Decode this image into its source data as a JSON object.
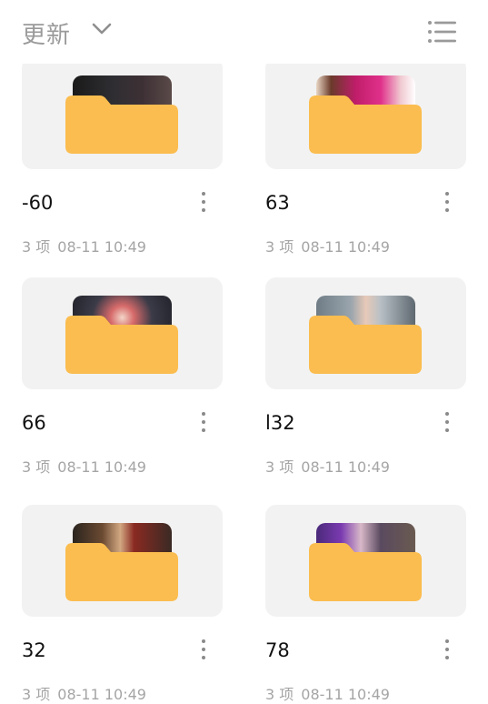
{
  "header": {
    "sort_label": "更新",
    "sort_icon": "chevron-down-icon",
    "view_icon": "list-view-icon"
  },
  "colors": {
    "folder": "#fbbd4f",
    "card_bg": "#f2f2f2",
    "name_text": "#111111",
    "meta_text": "#a5a5a5"
  },
  "folders": [
    {
      "name": "-60",
      "count": "3 项",
      "modified": "08-11 10:49"
    },
    {
      "name": "63",
      "count": "3 项",
      "modified": "08-11 10:49"
    },
    {
      "name": "66",
      "count": "3 项",
      "modified": "08-11 10:49"
    },
    {
      "name": "l32",
      "count": "3 项",
      "modified": "08-11 10:49"
    },
    {
      "name": "32",
      "count": "3 项",
      "modified": "08-11 10:49"
    },
    {
      "name": "78",
      "count": "3 项",
      "modified": "08-11 10:49"
    }
  ]
}
